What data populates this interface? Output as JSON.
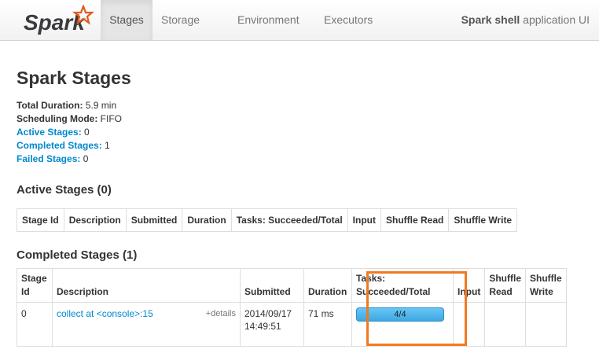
{
  "navbar": {
    "brand": "Spark",
    "tabs": [
      {
        "label": "Stages",
        "active": true
      },
      {
        "label": "Storage",
        "active": false
      },
      {
        "label": "Environment",
        "active": false
      },
      {
        "label": "Executors",
        "active": false
      }
    ],
    "app_title_bold": "Spark shell",
    "app_title_rest": " application UI"
  },
  "page_title": "Spark Stages",
  "summary": {
    "total_duration_label": "Total Duration:",
    "total_duration_value": " 5.9 min",
    "scheduling_mode_label": "Scheduling Mode:",
    "scheduling_mode_value": " FIFO",
    "active_stages_label": "Active Stages:",
    "active_stages_value": " 0",
    "completed_stages_label": "Completed Stages:",
    "completed_stages_value": " 1",
    "failed_stages_label": "Failed Stages:",
    "failed_stages_value": " 0"
  },
  "active_section": {
    "title": "Active Stages (0)",
    "headers": [
      "Stage Id",
      "Description",
      "Submitted",
      "Duration",
      "Tasks: Succeeded/Total",
      "Input",
      "Shuffle Read",
      "Shuffle Write"
    ]
  },
  "completed_section": {
    "title": "Completed Stages (1)",
    "headers": [
      "Stage Id",
      "Description",
      "Submitted",
      "Duration",
      "Tasks: Succeeded/Total",
      "Input",
      "Shuffle Read",
      "Shuffle Write"
    ],
    "rows": [
      {
        "stage_id": "0",
        "description": "collect at <console>:15",
        "details": "+details",
        "submitted": "2014/09/17 14:49:51",
        "duration": "71 ms",
        "tasks": "4/4",
        "tasks_fraction": 1.0,
        "input": "",
        "shuffle_read": "",
        "shuffle_write": ""
      }
    ]
  },
  "colors": {
    "link": "#0088cc",
    "progress_bar": "#3fa7e1",
    "highlight": "#f07a20",
    "spark_logo": "#e25a1c"
  }
}
